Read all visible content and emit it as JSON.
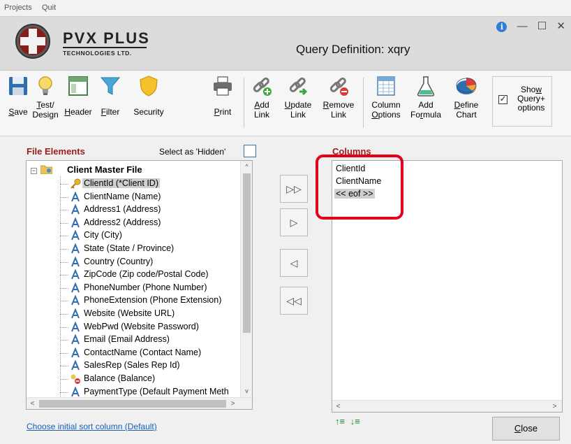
{
  "menu": {
    "projects": "Projects",
    "quit": "Quit"
  },
  "header": {
    "logo_main": "PVX PLUS",
    "logo_sub": "TECHNOLOGIES LTD.",
    "title": "Query Definition:  xqry",
    "info_icon": "i",
    "minimize": "—",
    "maximize": "☐",
    "close": "✕"
  },
  "toolbar": {
    "save": {
      "pre": "",
      "u": "S",
      "post": "ave"
    },
    "test1": {
      "u": "T",
      "post": "est/"
    },
    "test2": "Design",
    "header": {
      "u": "H",
      "post": "eader"
    },
    "filter": {
      "u": "F",
      "post": "ilter"
    },
    "security": "Security",
    "print": {
      "u": "P",
      "post": "rint"
    },
    "addlink1": {
      "u": "A",
      "post": "dd"
    },
    "addlink2": "Link",
    "updatelink1": {
      "u": "U",
      "post": "pdate"
    },
    "updatelink2": "Link",
    "removelink1": {
      "u": "R",
      "post": "emove"
    },
    "removelink2": "Link",
    "column1": "Column",
    "column2": {
      "u": "O",
      "post": "ptions"
    },
    "formula1": "Add",
    "formula2": {
      "pre": "Fo",
      "u": "r",
      "post": "mula"
    },
    "chart1": {
      "u": "D",
      "post": "efine"
    },
    "chart2": "Chart",
    "show_options": {
      "pre": "Sho",
      "u": "w",
      "line2": "Query+",
      "line3": "options",
      "checked": true
    }
  },
  "file_elements": {
    "title": "File Elements",
    "hidden_label": "Select as 'Hidden'",
    "root": "Client Master File",
    "items": [
      {
        "label": "ClientId (*Client ID)",
        "icon": "key-icon",
        "selected": true
      },
      {
        "label": "ClientName (Name)",
        "icon": "text-field-icon"
      },
      {
        "label": "Address1 (Address)",
        "icon": "text-field-icon"
      },
      {
        "label": "Address2 (Address)",
        "icon": "text-field-icon"
      },
      {
        "label": "City (City)",
        "icon": "text-field-icon"
      },
      {
        "label": "State (State / Province)",
        "icon": "text-field-icon"
      },
      {
        "label": "Country (Country)",
        "icon": "text-field-icon"
      },
      {
        "label": "ZipCode (Zip code/Postal Code)",
        "icon": "text-field-icon"
      },
      {
        "label": "PhoneNumber (Phone Number)",
        "icon": "text-field-icon"
      },
      {
        "label": "PhoneExtension (Phone Extension)",
        "icon": "text-field-icon"
      },
      {
        "label": "Website (Website URL)",
        "icon": "text-field-icon"
      },
      {
        "label": "WebPwd (Website Password)",
        "icon": "text-field-icon"
      },
      {
        "label": "Email (Email Address)",
        "icon": "text-field-icon"
      },
      {
        "label": "ContactName (Contact Name)",
        "icon": "text-field-icon"
      },
      {
        "label": "SalesRep (Sales Rep Id)",
        "icon": "text-field-icon"
      },
      {
        "label": "Balance (Balance)",
        "icon": "numeric-field-icon"
      },
      {
        "label": "PaymentType (Default Payment Meth",
        "icon": "text-field-icon"
      }
    ]
  },
  "move": {
    "all_right": "▷▷",
    "right": "▷",
    "left": "◁",
    "all_left": "◁◁"
  },
  "columns": {
    "title": "Columns",
    "items": [
      "ClientId",
      "ClientName"
    ],
    "eof": "<< eof >>"
  },
  "footer": {
    "sort_link": "Choose initial sort column (Default)",
    "sort_up": "↑≡",
    "sort_down": "↓≡",
    "close_u": "C",
    "close_post": "lose"
  },
  "colors": {
    "section_title": "#9b1b1b",
    "highlight": "#e3001b",
    "link": "#1a5fb4"
  }
}
